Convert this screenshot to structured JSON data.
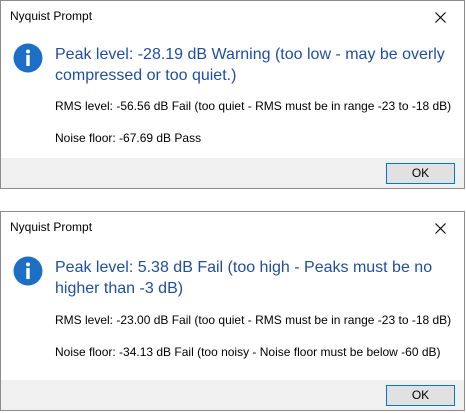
{
  "dialogs": [
    {
      "title": "Nyquist Prompt",
      "peak": "Peak level:  -28.19 dB  Warning (too low - may be overly compressed or too quiet.)",
      "rms": "RMS level:  -56.56 dB  Fail (too quiet - RMS must be in range -23 to -18 dB)",
      "noise": "Noise floor:  -67.69 dB  Pass",
      "ok": "OK"
    },
    {
      "title": "Nyquist Prompt",
      "peak": "Peak level:  5.38 dB  Fail (too high - Peaks must be no higher than -3 dB)",
      "rms": "RMS level:  -23.00 dB  Fail (too quiet - RMS must be in range -23 to -18 dB)",
      "noise": "Noise floor:  -34.13 dB  Fail (too noisy - Noise floor must be below -60 dB)",
      "ok": "OK"
    }
  ],
  "icons": {
    "info": "info-icon",
    "close": "close-icon"
  },
  "colors": {
    "message": "#1f4e9e",
    "icon": "#1c6fc4",
    "footer": "#f0f0f0",
    "button_border": "#0078d7"
  }
}
